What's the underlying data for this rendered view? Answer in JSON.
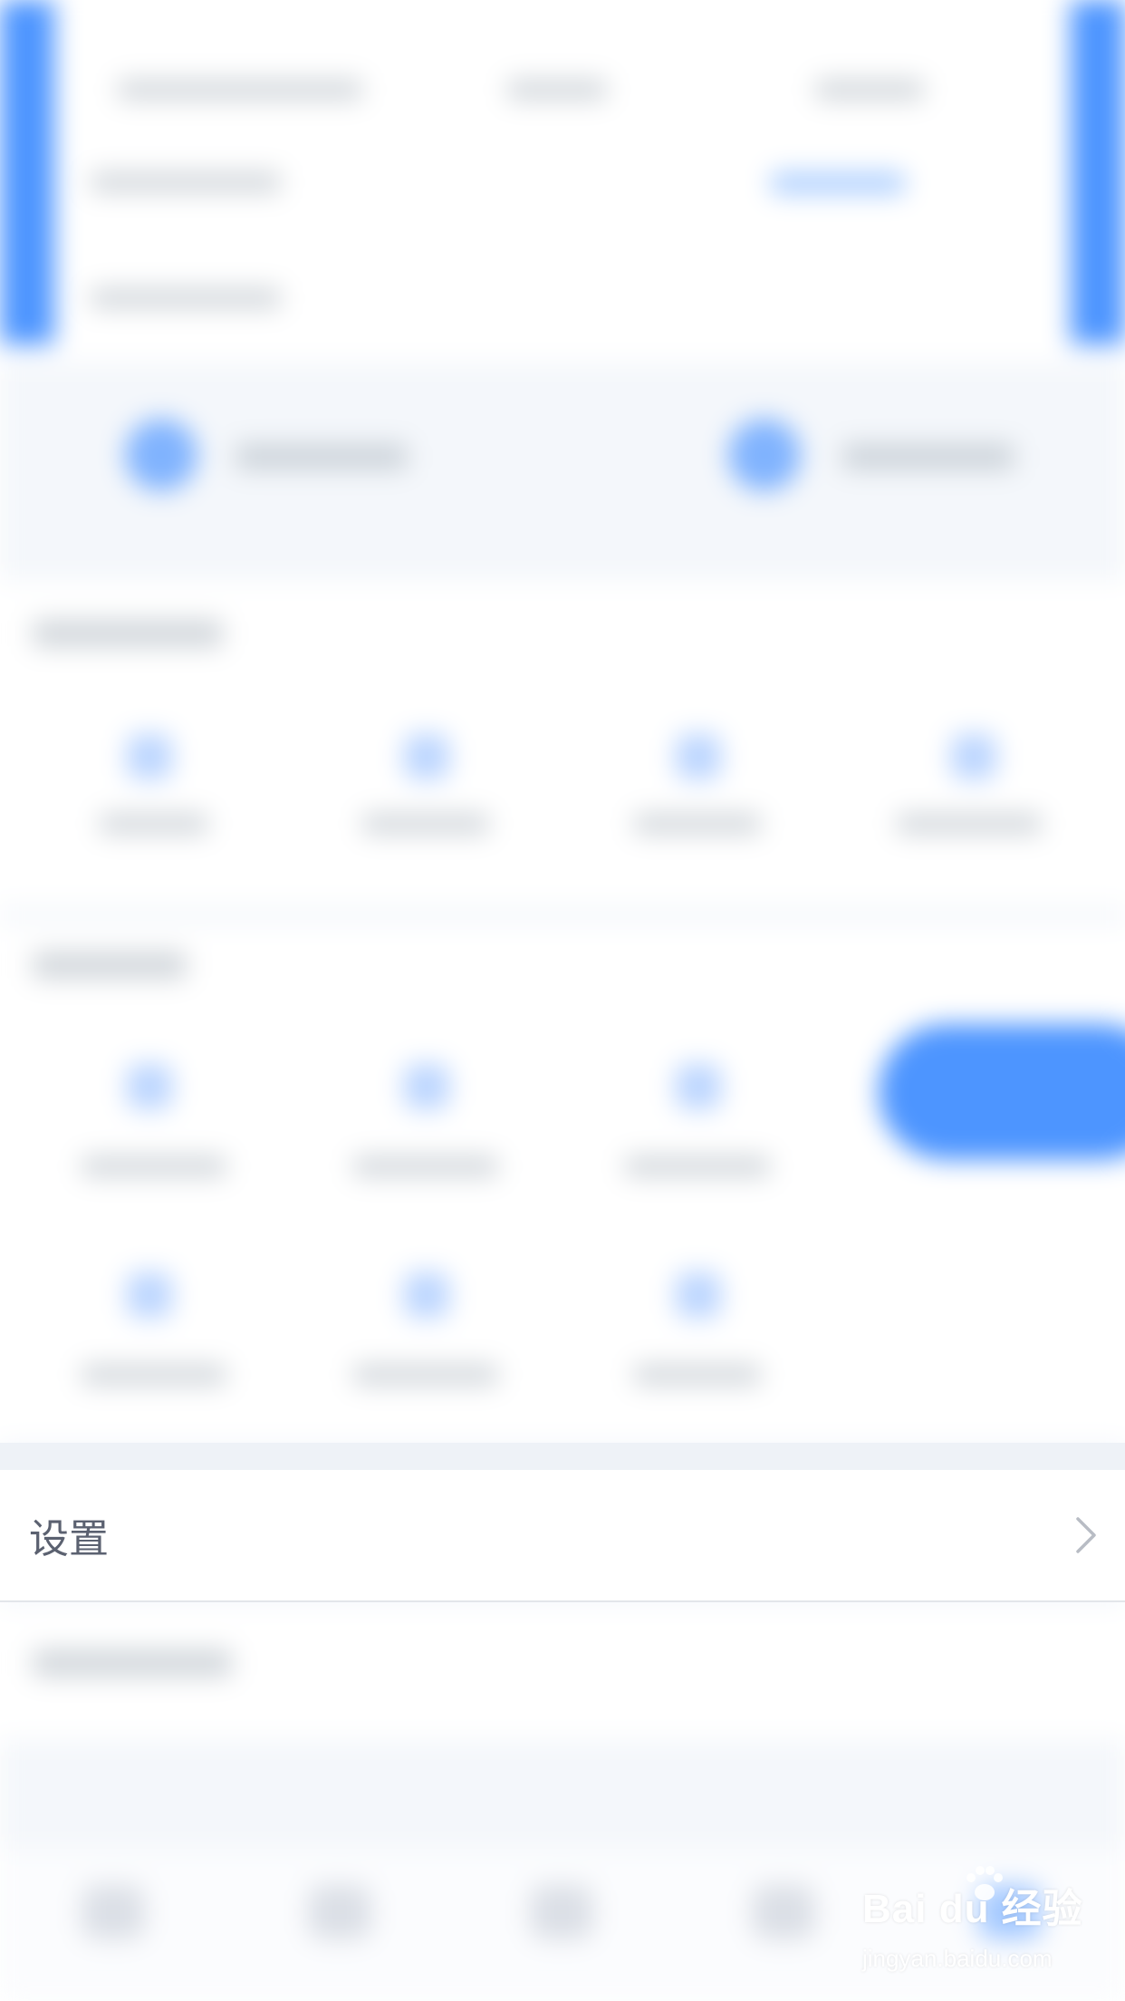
{
  "settings": {
    "label": "设置"
  },
  "watermark": {
    "brand": "Bai du 经验",
    "url": "jingyan.baidu.com"
  },
  "colors": {
    "accent": "#4d95ff",
    "label_text": "#5b6170",
    "chevron": "#b8bcc4",
    "divider": "#e3e6ea",
    "band": "#eef2f7"
  },
  "icons": {
    "chevron": "chevron-right-icon",
    "watermark_logo": "baidu-paw-icon"
  }
}
